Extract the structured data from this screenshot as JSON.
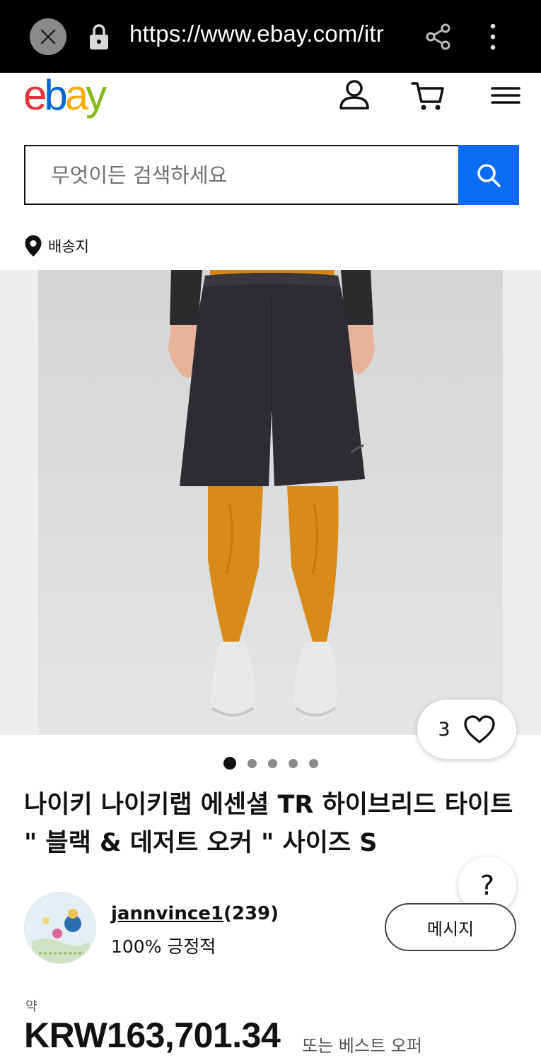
{
  "browser": {
    "url": "https://www.ebay.com/itr",
    "icons": [
      "close-icon",
      "lock-icon",
      "share-icon",
      "more-vert-icon"
    ]
  },
  "header": {
    "logo": {
      "e": "e",
      "b": "b",
      "a": "a",
      "y": "y"
    },
    "icons": [
      "account-icon",
      "cart-icon",
      "menu-icon"
    ]
  },
  "search": {
    "placeholder": "무엇이든 검색하세요",
    "value": "",
    "button_icon": "search-icon",
    "accent": "#0a6cf5"
  },
  "ship_to": {
    "label": "배송지",
    "icon": "location-pin-icon"
  },
  "gallery": {
    "favorite_count": "3",
    "favorite_icon": "heart-icon",
    "page_count": 5,
    "active_index": 0
  },
  "listing": {
    "title": "나이키 나이키랩 에센셜 TR 하이브리드 타이트 \" 블랙 & 데저트 오커 \" 사이즈 S"
  },
  "help": {
    "label": "?"
  },
  "seller": {
    "name": "jannvince1",
    "score": "(239)",
    "feedback": "100% 긍정적",
    "message_button": "메시지"
  },
  "pricing": {
    "approx_label": "약",
    "price": "KRW163,701.34",
    "best_offer": "또는 베스트 오퍼"
  }
}
